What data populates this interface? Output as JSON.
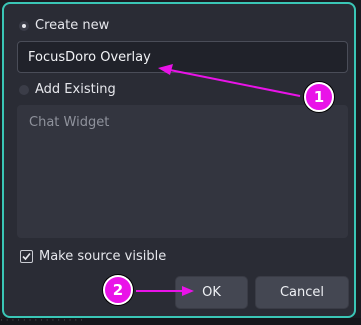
{
  "dialog": {
    "create_new_label": "Create new",
    "source_name_value": "FocusDoro Overlay",
    "add_existing_label": "Add Existing",
    "existing_sources": [
      "Chat Widget"
    ],
    "make_visible_label": "Make source visible",
    "make_visible_checked": true,
    "ok_label": "OK",
    "cancel_label": "Cancel"
  },
  "annotations": {
    "step1": "1",
    "step2": "2",
    "color": "#e913e8"
  },
  "accent_color": "#3ac6b6",
  "bottom_strip_text": "· · · · · · · · · · · · · · ·"
}
